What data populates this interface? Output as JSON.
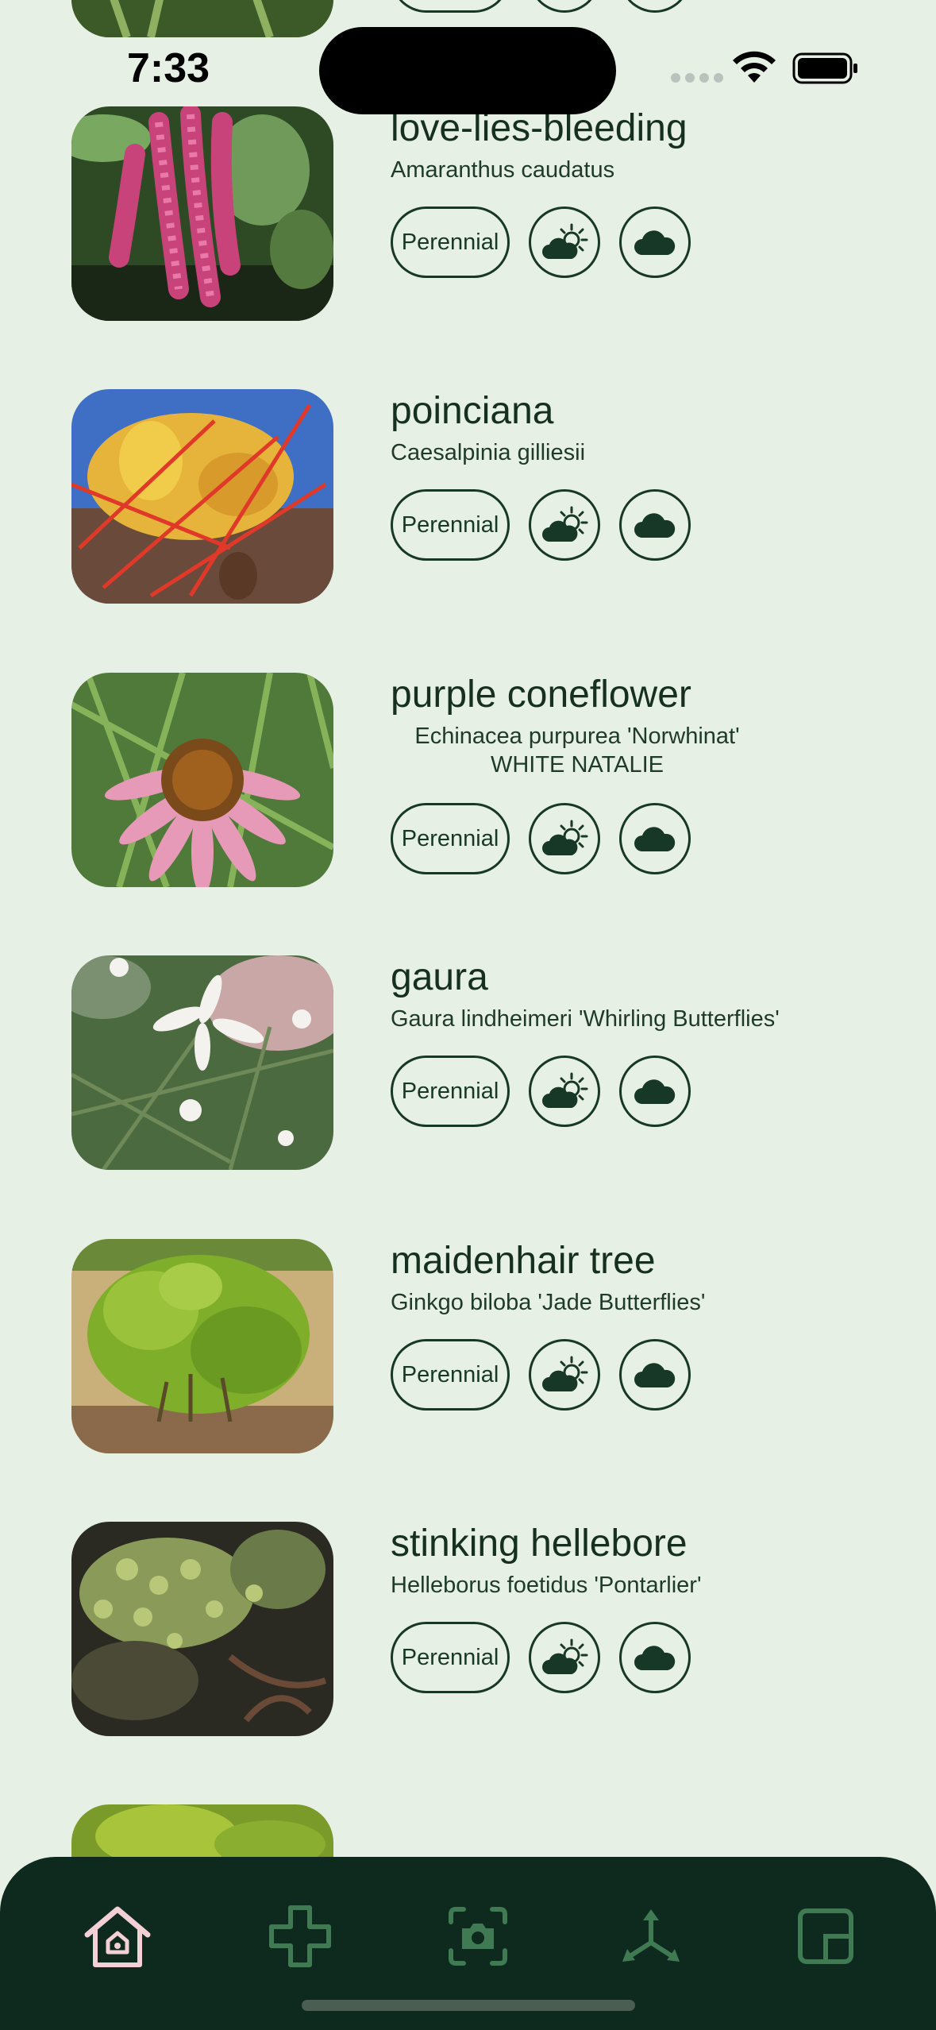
{
  "status_bar": {
    "time": "7:33"
  },
  "plants": [
    {
      "common_name": "love-lies-bleeding",
      "scientific_name": "Amaranthus caudatus",
      "life_cycle": "Perennial",
      "sun_icon": "partly-sunny-icon",
      "water_icon": "cloud-icon"
    },
    {
      "common_name": "poinciana",
      "scientific_name": "Caesalpinia gilliesii",
      "life_cycle": "Perennial",
      "sun_icon": "partly-sunny-icon",
      "water_icon": "cloud-icon"
    },
    {
      "common_name": "purple coneflower",
      "scientific_name_line1": "Echinacea purpurea 'Norwhinat'",
      "scientific_name_line2": "WHITE NATALIE",
      "life_cycle": "Perennial",
      "sun_icon": "partly-sunny-icon",
      "water_icon": "cloud-icon"
    },
    {
      "common_name": "gaura",
      "scientific_name": "Gaura lindheimeri 'Whirling Butterflies'",
      "life_cycle": "Perennial",
      "sun_icon": "partly-sunny-icon",
      "water_icon": "cloud-icon"
    },
    {
      "common_name": "maidenhair tree",
      "scientific_name": "Ginkgo biloba 'Jade Butterflies'",
      "life_cycle": "Perennial",
      "sun_icon": "partly-sunny-icon",
      "water_icon": "cloud-icon"
    },
    {
      "common_name": "stinking hellebore",
      "scientific_name": "Helleborus foetidus 'Pontarlier'",
      "life_cycle": "Perennial",
      "sun_icon": "partly-sunny-icon",
      "water_icon": "cloud-icon"
    }
  ],
  "tab_bar": {
    "tabs": [
      {
        "icon": "home-icon",
        "active": true
      },
      {
        "icon": "plus-icon",
        "active": false
      },
      {
        "icon": "camera-icon",
        "active": false
      },
      {
        "icon": "network-icon",
        "active": false
      },
      {
        "icon": "picture-in-picture-icon",
        "active": false
      }
    ]
  },
  "colors": {
    "background": "#e7f0e4",
    "ink": "#173826",
    "tab_bar": "#0e2a1f",
    "tab_active": "#f3cfd6",
    "tab_inactive": "#3f7a53"
  }
}
